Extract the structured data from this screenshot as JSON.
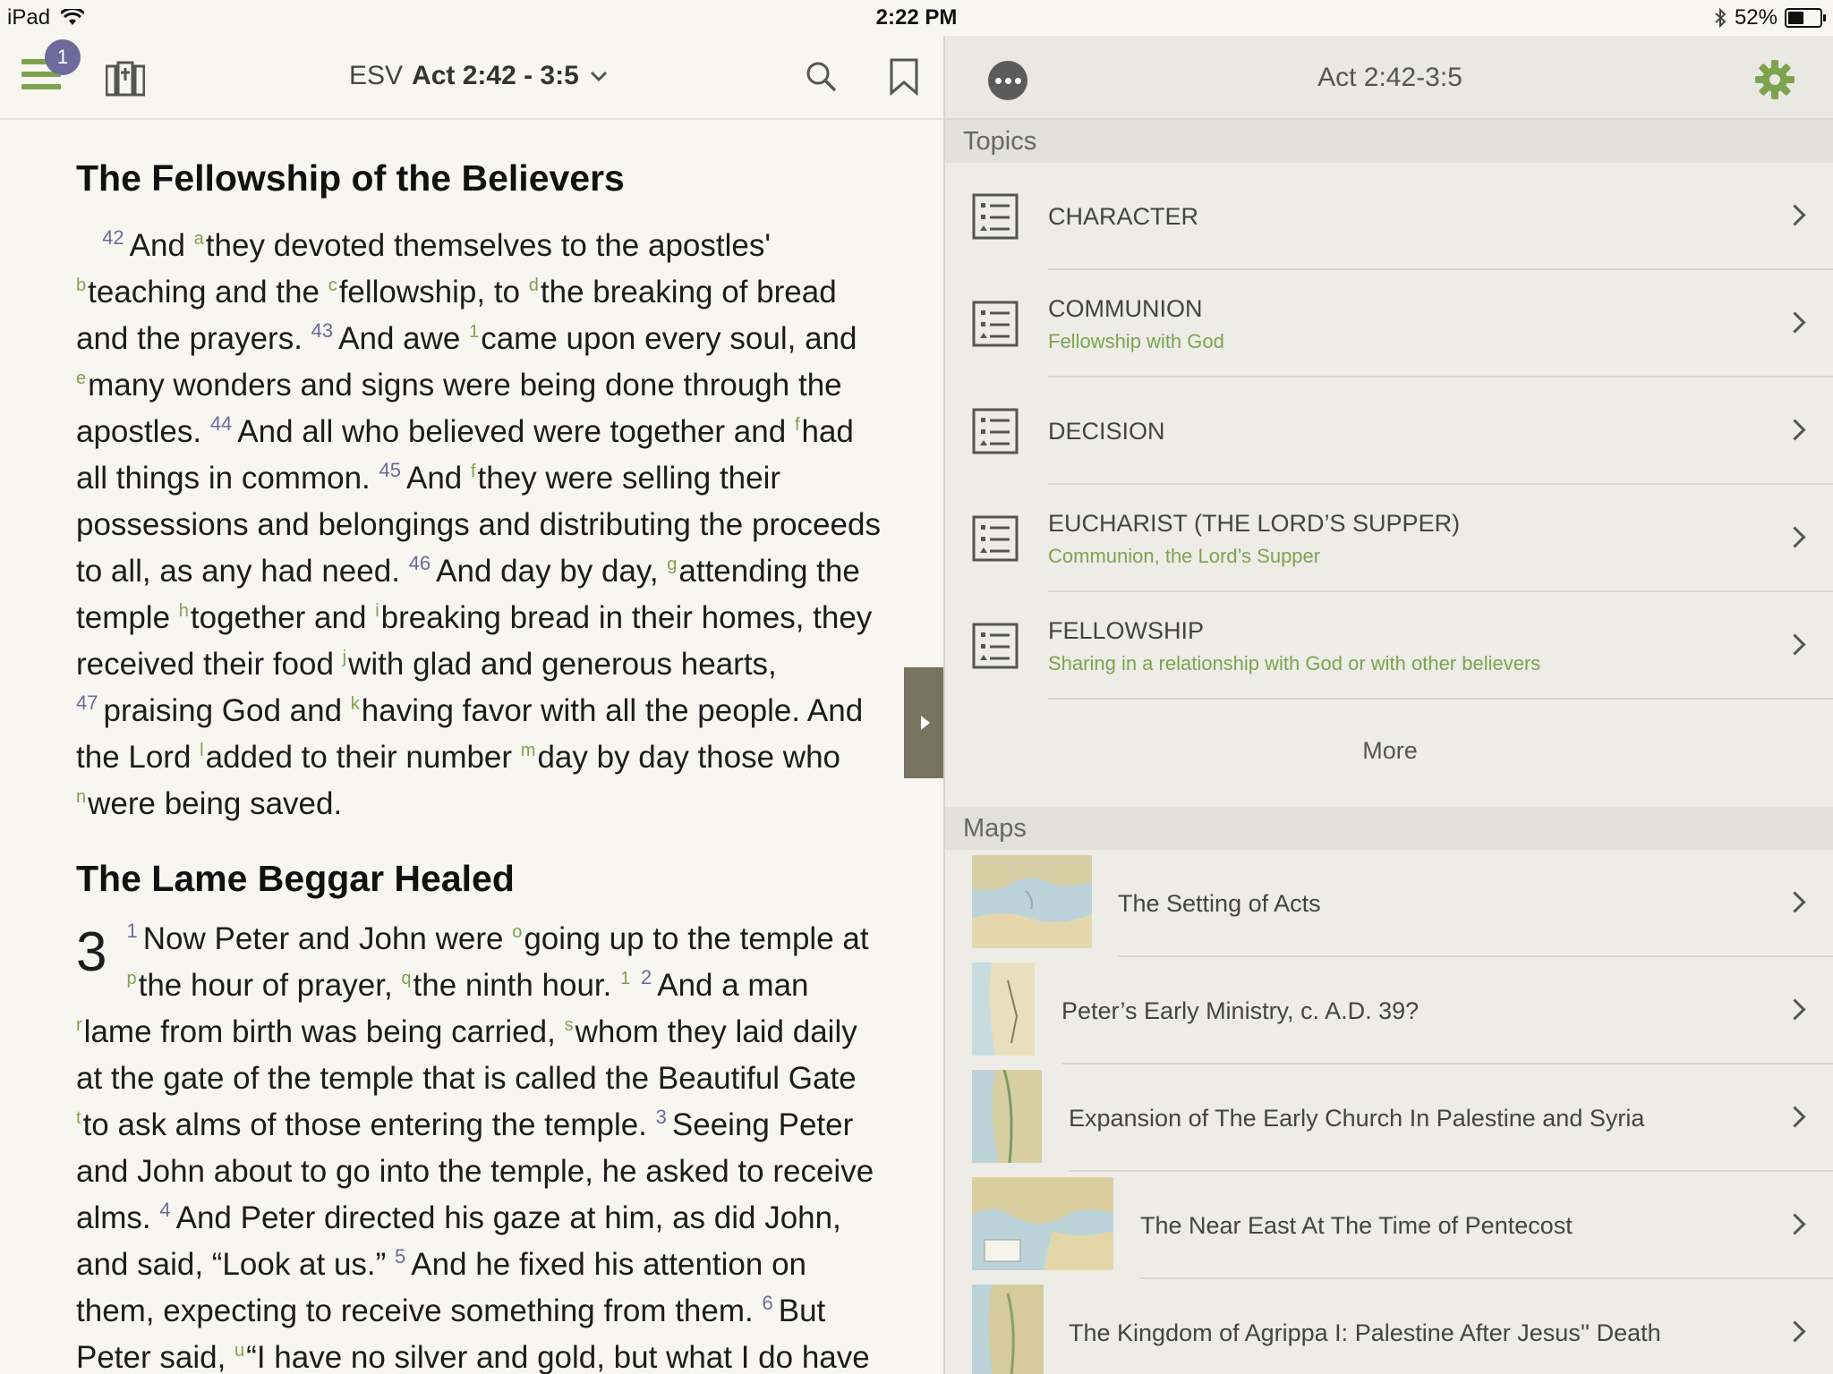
{
  "status": {
    "device": "iPad",
    "time": "2:22 PM",
    "battery": "52%",
    "battery_level": 0.52
  },
  "reader_toolbar": {
    "badge": "1",
    "version": "ESV",
    "reference": "Act 2:42 - 3:5"
  },
  "passage": {
    "heading1": "The Fellowship of the Believers",
    "heading2": "The Lame Beggar Healed",
    "chapter": "3"
  },
  "resources": {
    "title": "Act 2:42-3:5",
    "topics_header": "Topics",
    "topics": [
      {
        "title": "CHARACTER",
        "subtitle": ""
      },
      {
        "title": "COMMUNION",
        "subtitle": "Fellowship with God"
      },
      {
        "title": "DECISION",
        "subtitle": ""
      },
      {
        "title": "EUCHARIST (THE LORD’S SUPPER)",
        "subtitle": "Communion, the Lord’s Supper"
      },
      {
        "title": "FELLOWSHIP",
        "subtitle": "Sharing in a relationship with God or with other believers"
      }
    ],
    "more_label": "More",
    "maps_header": "Maps",
    "maps": [
      {
        "title": "The Setting of Acts"
      },
      {
        "title": "Peter’s Early Ministry, c. A.D. 39?"
      },
      {
        "title": "Expansion of The Early Church In Palestine and Syria"
      },
      {
        "title": "The Near East At The Time of Pentecost"
      },
      {
        "title": "The Kingdom of Agrippa I: Palestine After Jesus'' Death"
      }
    ]
  },
  "colors": {
    "accent": "#7ea34e",
    "verse_number": "#6d6a9c",
    "badge": "#6e6a9c"
  }
}
